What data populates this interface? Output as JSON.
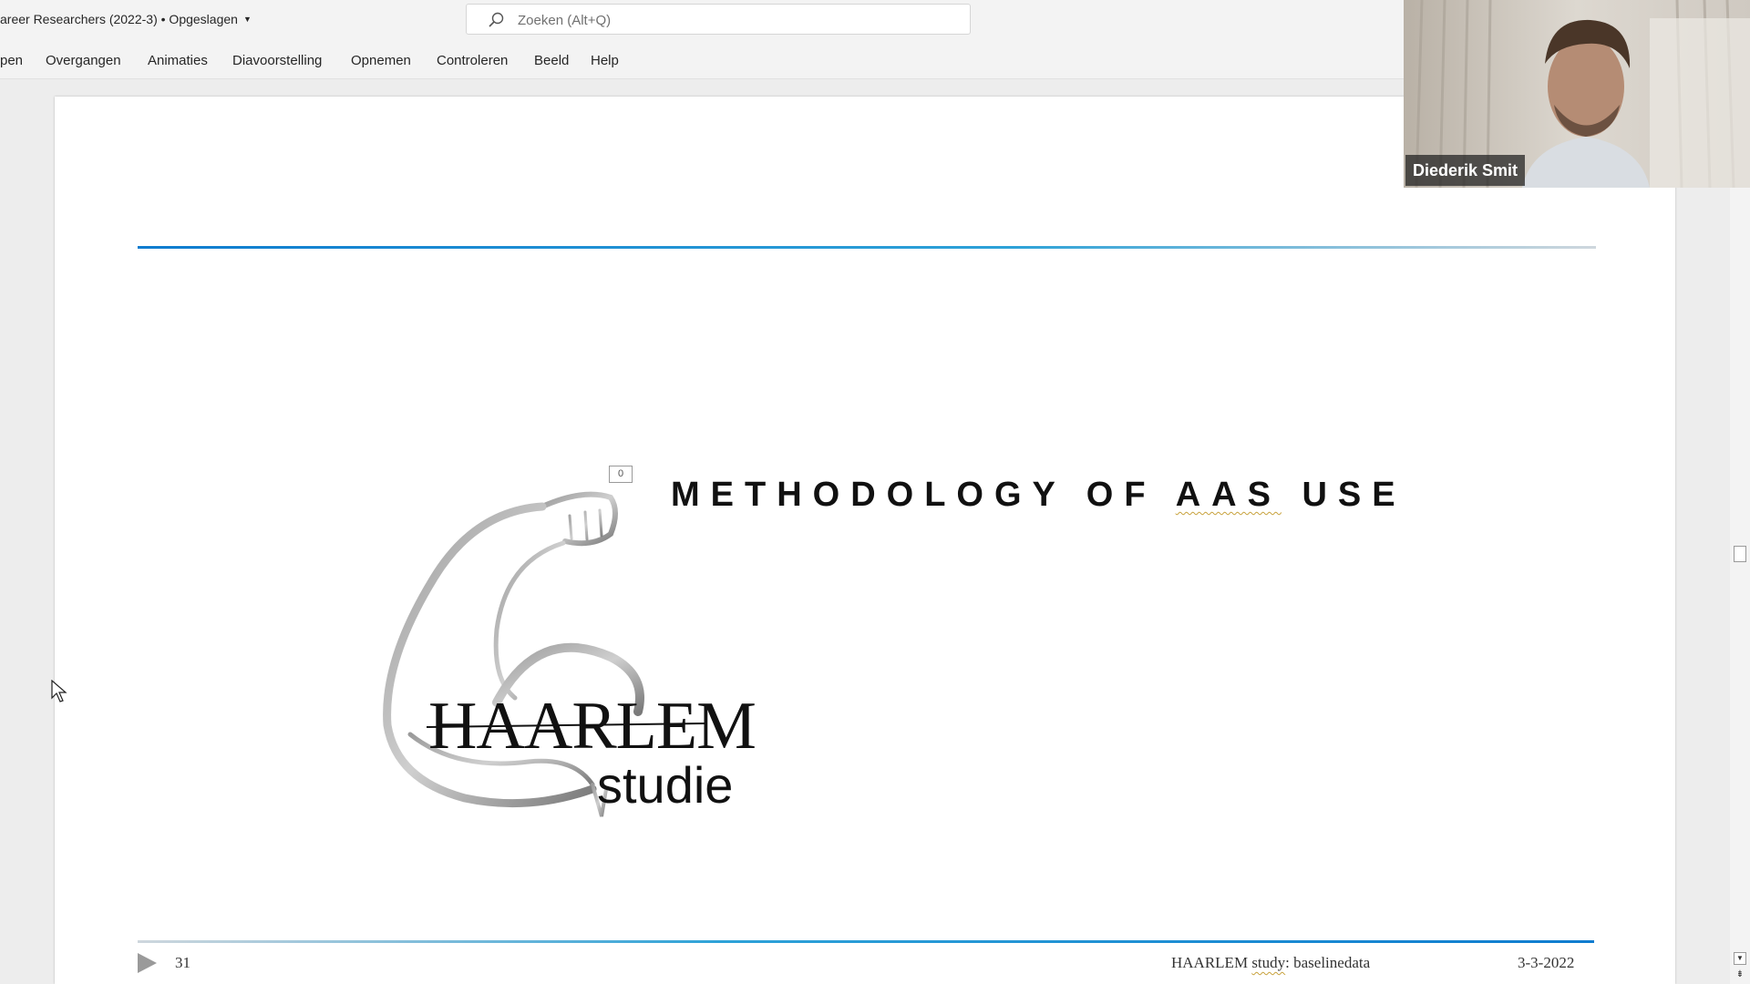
{
  "titlebar": {
    "document_title": "areer Researchers (2022-3) • Opgeslagen",
    "search_placeholder": "Zoeken (Alt+Q)"
  },
  "ribbon": {
    "tabs": [
      {
        "label": "pen"
      },
      {
        "label": "Overgangen"
      },
      {
        "label": "Animaties"
      },
      {
        "label": "Diavoorstelling"
      },
      {
        "label": "Opnemen"
      },
      {
        "label": "Controleren"
      },
      {
        "label": "Beeld"
      },
      {
        "label": "Help"
      }
    ]
  },
  "slide": {
    "title_part1": "METHODOLOGY OF ",
    "title_part2": "AAS",
    "title_part3": " USE",
    "animation_tag": "0",
    "logo": {
      "line1": "HAARLEM",
      "line2": "studie"
    },
    "footer": {
      "slide_number": "31",
      "center_part1": "HAARLEM ",
      "center_part2": "study",
      "center_part3": ": baselinedata",
      "date": "3-3-2022"
    }
  },
  "webcam": {
    "participant_name": "Diederik Smit"
  },
  "colors": {
    "accent_rule": "#0f7ccf",
    "spelling_underline": "#c8a23c",
    "ribbon_bg": "#f3f3f3"
  }
}
